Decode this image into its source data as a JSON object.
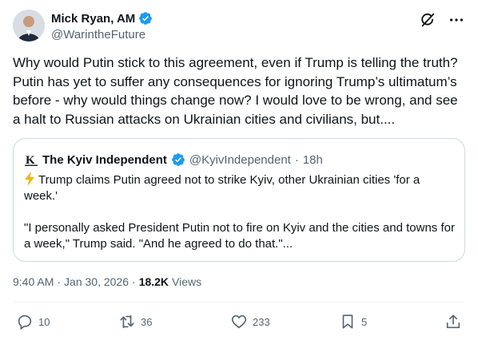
{
  "author": {
    "name": "Mick Ryan, AM",
    "handle": "@WarintheFuture",
    "avatar_icon": "avatar-photo",
    "verified_icon": "verified-badge-icon"
  },
  "header_icons": [
    "grok-icon",
    "more-icon"
  ],
  "post": {
    "text": "Why would Putin stick to this agreement, even if Trump is telling the truth? Putin has yet to suffer any consequences for ignoring Trump’s ultimatum’s before - why would things change now? I would love to be wrong, and see a halt to Russian attacks on Ukrainian cities and civilians, but...."
  },
  "quote": {
    "source_name": "The Kyiv Independent",
    "source_handle": "@KyivIndependent",
    "separator": "·",
    "age": "18h",
    "line1": "Trump claims Putin agreed not to strike Kyiv, other Ukrainian cities 'for a week.'",
    "line2": "\"I personally asked President Putin not to fire on Kyiv and the cities and towns for a week,\" Trump said. \"And he agreed to do that.\"..."
  },
  "meta": {
    "time": "9:40 AM",
    "separator": "·",
    "date": "Jan 30, 2026",
    "views_count": "18.2K",
    "views_label": "Views"
  },
  "actions": {
    "replies": "10",
    "reposts": "36",
    "likes": "233",
    "bookmarks": "5"
  },
  "colors": {
    "text": "#0f1419",
    "secondary": "#536471",
    "verified": "#1d9bf0",
    "border": "#cfd9de"
  }
}
